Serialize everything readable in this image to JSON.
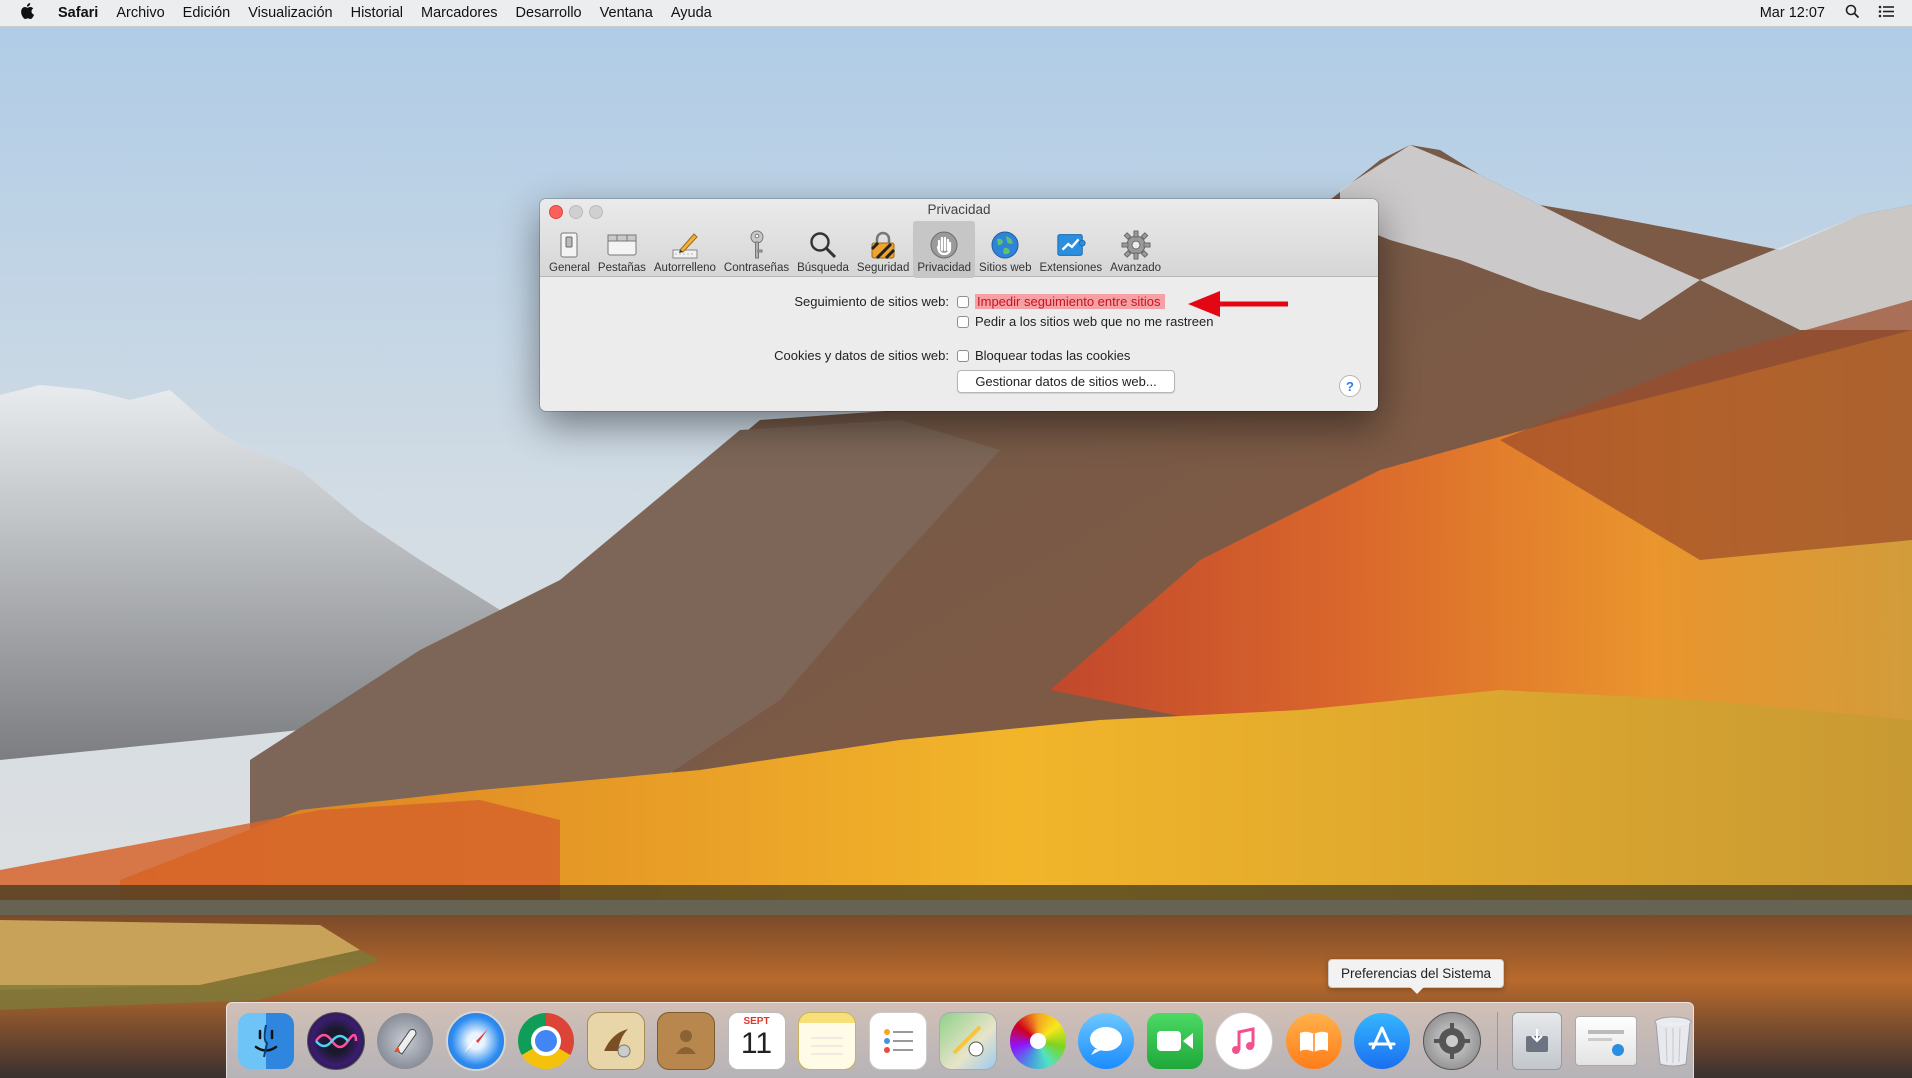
{
  "menubar": {
    "apple_icon": "apple-icon",
    "app_name": "Safari",
    "items": [
      "Archivo",
      "Edición",
      "Visualización",
      "Historial",
      "Marcadores",
      "Desarrollo",
      "Ventana",
      "Ayuda"
    ],
    "clock": "Mar 12:07",
    "right_icons": [
      "search-icon",
      "list-icon"
    ]
  },
  "window": {
    "title": "Privacidad",
    "toolbar": [
      {
        "label": "General",
        "icon": "switch-icon"
      },
      {
        "label": "Pestañas",
        "icon": "tabs-icon"
      },
      {
        "label": "Autorrelleno",
        "icon": "pencil-icon"
      },
      {
        "label": "Contraseñas",
        "icon": "key-icon"
      },
      {
        "label": "Búsqueda",
        "icon": "magnifier-icon"
      },
      {
        "label": "Seguridad",
        "icon": "padlock-icon"
      },
      {
        "label": "Privacidad",
        "icon": "hand-icon",
        "selected": true
      },
      {
        "label": "Sitios web",
        "icon": "globe-icon"
      },
      {
        "label": "Extensiones",
        "icon": "puzzle-icon"
      },
      {
        "label": "Avanzado",
        "icon": "gear-icon"
      }
    ],
    "tracking_label": "Seguimiento de sitios web:",
    "prevent_tracking": {
      "label": "Impedir seguimiento entre sitios",
      "checked": false
    },
    "ask_not_track": {
      "label": "Pedir a los sitios web que no me rastreen",
      "checked": false
    },
    "cookies_label": "Cookies y datos de sitios web:",
    "block_cookies": {
      "label": "Bloquear todas las cookies",
      "checked": false
    },
    "manage_button": "Gestionar datos de sitios web...",
    "help": "?"
  },
  "tooltip": "Preferencias del Sistema",
  "dock": {
    "apps": [
      "Finder",
      "Siri",
      "Launchpad",
      "Safari",
      "Chrome",
      "Mail",
      "Contactos",
      "Calendario",
      "Notas",
      "Recordatorios",
      "Mapas",
      "Fotos",
      "Mensajes",
      "FaceTime",
      "iTunes",
      "iBooks",
      "App Store",
      "Preferencias del Sistema"
    ],
    "calendar_month": "SEPT",
    "calendar_day": "11",
    "others": [
      "Descargas",
      "Documentos",
      "Papelera"
    ]
  },
  "colors": {
    "highlight_bg": "#f6a0a6",
    "highlight_text": "#c2171f",
    "arrow": "#e30613",
    "close_light": "#fc605c",
    "accent": "#2d7bf5"
  }
}
